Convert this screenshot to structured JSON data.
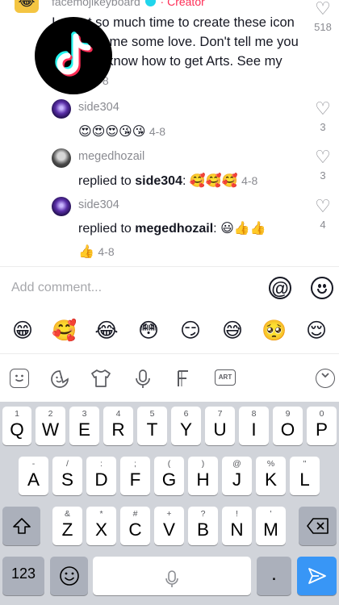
{
  "top_comment": {
    "avatar": "😂",
    "author": "facemojikeyboard",
    "creator_label": "Creator",
    "text": "I spent so much time to create these icon art, show me some love. Don't tell me you still don't know how to get Arts. See my name!",
    "date": "4-8",
    "likes": "518"
  },
  "replies": [
    {
      "author": "side304",
      "text_emoji": "😍😍😍😘😘",
      "date": "4-8",
      "likes": "3",
      "avatar": "purple"
    },
    {
      "author": "megedhozail",
      "prefix": "replied to ",
      "target": "side304",
      "sep": ": ",
      "text_emoji": "🥰🥰🥰",
      "date": "4-8",
      "likes": "3",
      "avatar": "gray"
    },
    {
      "author": "side304",
      "prefix": "replied to ",
      "target": "megedhozail",
      "sep": ": ",
      "text_emoji": "😃👍👍",
      "line2_emoji": "👍",
      "date": "4-8",
      "likes": "4",
      "avatar": "purple"
    }
  ],
  "input": {
    "placeholder": "Add comment..."
  },
  "icons": {
    "at": "@",
    "heart": "♡"
  },
  "emoji_row": [
    "😁",
    "🥰",
    "😂",
    "😳",
    "😏",
    "😅",
    "🥺",
    "😌"
  ],
  "toolbar": [
    "emoji-sticker-icon",
    "sticker-face-icon",
    "tshirt-icon",
    "mic-icon",
    "font-icon",
    "art-icon",
    "collapse-icon"
  ],
  "toolbar_art_label": "ART",
  "keyboard": {
    "row1": [
      [
        "1",
        "Q"
      ],
      [
        "2",
        "W"
      ],
      [
        "3",
        "E"
      ],
      [
        "4",
        "R"
      ],
      [
        "5",
        "T"
      ],
      [
        "6",
        "Y"
      ],
      [
        "7",
        "U"
      ],
      [
        "8",
        "I"
      ],
      [
        "9",
        "O"
      ],
      [
        "0",
        "P"
      ]
    ],
    "row2": [
      [
        "-",
        "A"
      ],
      [
        "/",
        "S"
      ],
      [
        ":",
        "D"
      ],
      [
        ";",
        "F"
      ],
      [
        "(",
        "G"
      ],
      [
        ")",
        "H"
      ],
      [
        "@",
        "J"
      ],
      [
        "%",
        "K"
      ],
      [
        "\"",
        "L"
      ]
    ],
    "row3": [
      [
        "&",
        "Z"
      ],
      [
        "*",
        "X"
      ],
      [
        "#",
        "C"
      ],
      [
        "+",
        "V"
      ],
      [
        "?",
        "B"
      ],
      [
        "!",
        "N"
      ],
      [
        "'",
        "M"
      ]
    ],
    "numbers_label": "123",
    "period": "."
  },
  "colors": {
    "creator": "#fe2c55",
    "keyboard_bg": "#d1d4da",
    "return_key": "#3896f6"
  }
}
